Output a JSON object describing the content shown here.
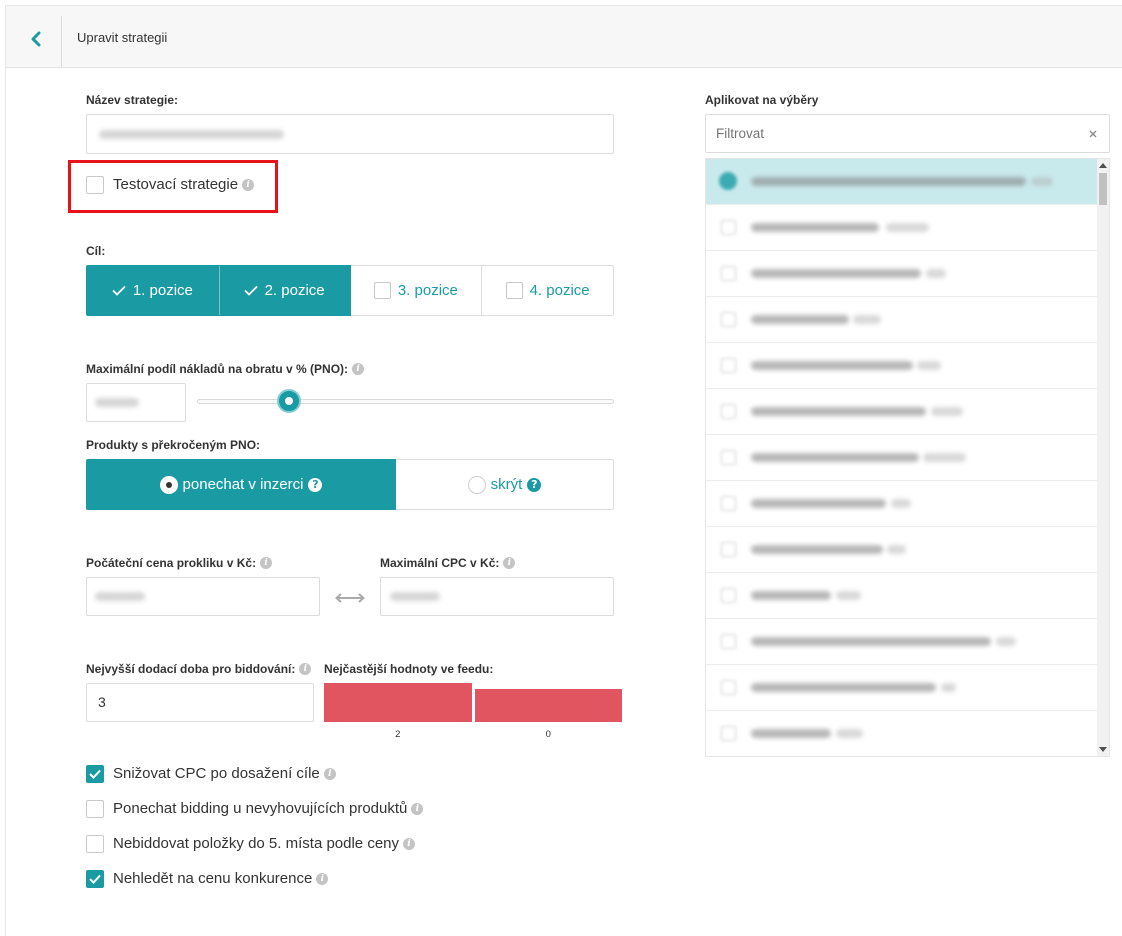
{
  "header": {
    "title": "Upravit strategii",
    "back_icon": "chevron-left-icon"
  },
  "colors": {
    "accent": "#1a9ba4",
    "row_highlight": "#c9eaed",
    "outline_red": "#e8121b",
    "bar": "#e05560"
  },
  "strategy_name": {
    "label": "Název strategie:"
  },
  "test_strategy": {
    "label": "Testovací strategie",
    "checked": false,
    "icon": "info-icon"
  },
  "goal": {
    "label": "Cíl:",
    "options": [
      {
        "label": "1. pozice",
        "selected": true
      },
      {
        "label": "2. pozice",
        "selected": true
      },
      {
        "label": "3. pozice",
        "selected": false
      },
      {
        "label": "4. pozice",
        "selected": false
      }
    ]
  },
  "pno": {
    "label": "Maximální podíl nákladů na obratu v % (PNO):",
    "slider_level": 0.22
  },
  "over_pno": {
    "label": "Produkty s překročeným PNO:",
    "options": [
      {
        "label": "ponechat v inzerci",
        "selected": true
      },
      {
        "label": "skrýt",
        "selected": false
      }
    ],
    "icon": "question-circle-icon"
  },
  "start_cpc": {
    "label": "Počáteční cena prokliku v Kč:"
  },
  "max_cpc": {
    "label": "Maximální CPC v Kč:"
  },
  "delivery_time": {
    "label": "Nejvyšší dodací doba pro biddování:",
    "value": "3"
  },
  "feed_values": {
    "label": "Nejčastější hodnoty ve feedu:",
    "categories": [
      "2",
      "0"
    ],
    "levels": [
      1.0,
      0.85
    ]
  },
  "options": [
    {
      "label": "Snižovat CPC po dosažení cíle",
      "checked": true
    },
    {
      "label": "Ponechat bidding u nevyhovujících produktů",
      "checked": false
    },
    {
      "label": "Nebiddovat položky do 5. místa podle ceny",
      "checked": false
    },
    {
      "label": "Nehledět na cenu konkurence",
      "checked": true
    }
  ],
  "selections": {
    "label": "Aplikovat na výběry",
    "filter_placeholder": "Filtrovat",
    "clear_icon": "close-icon"
  }
}
